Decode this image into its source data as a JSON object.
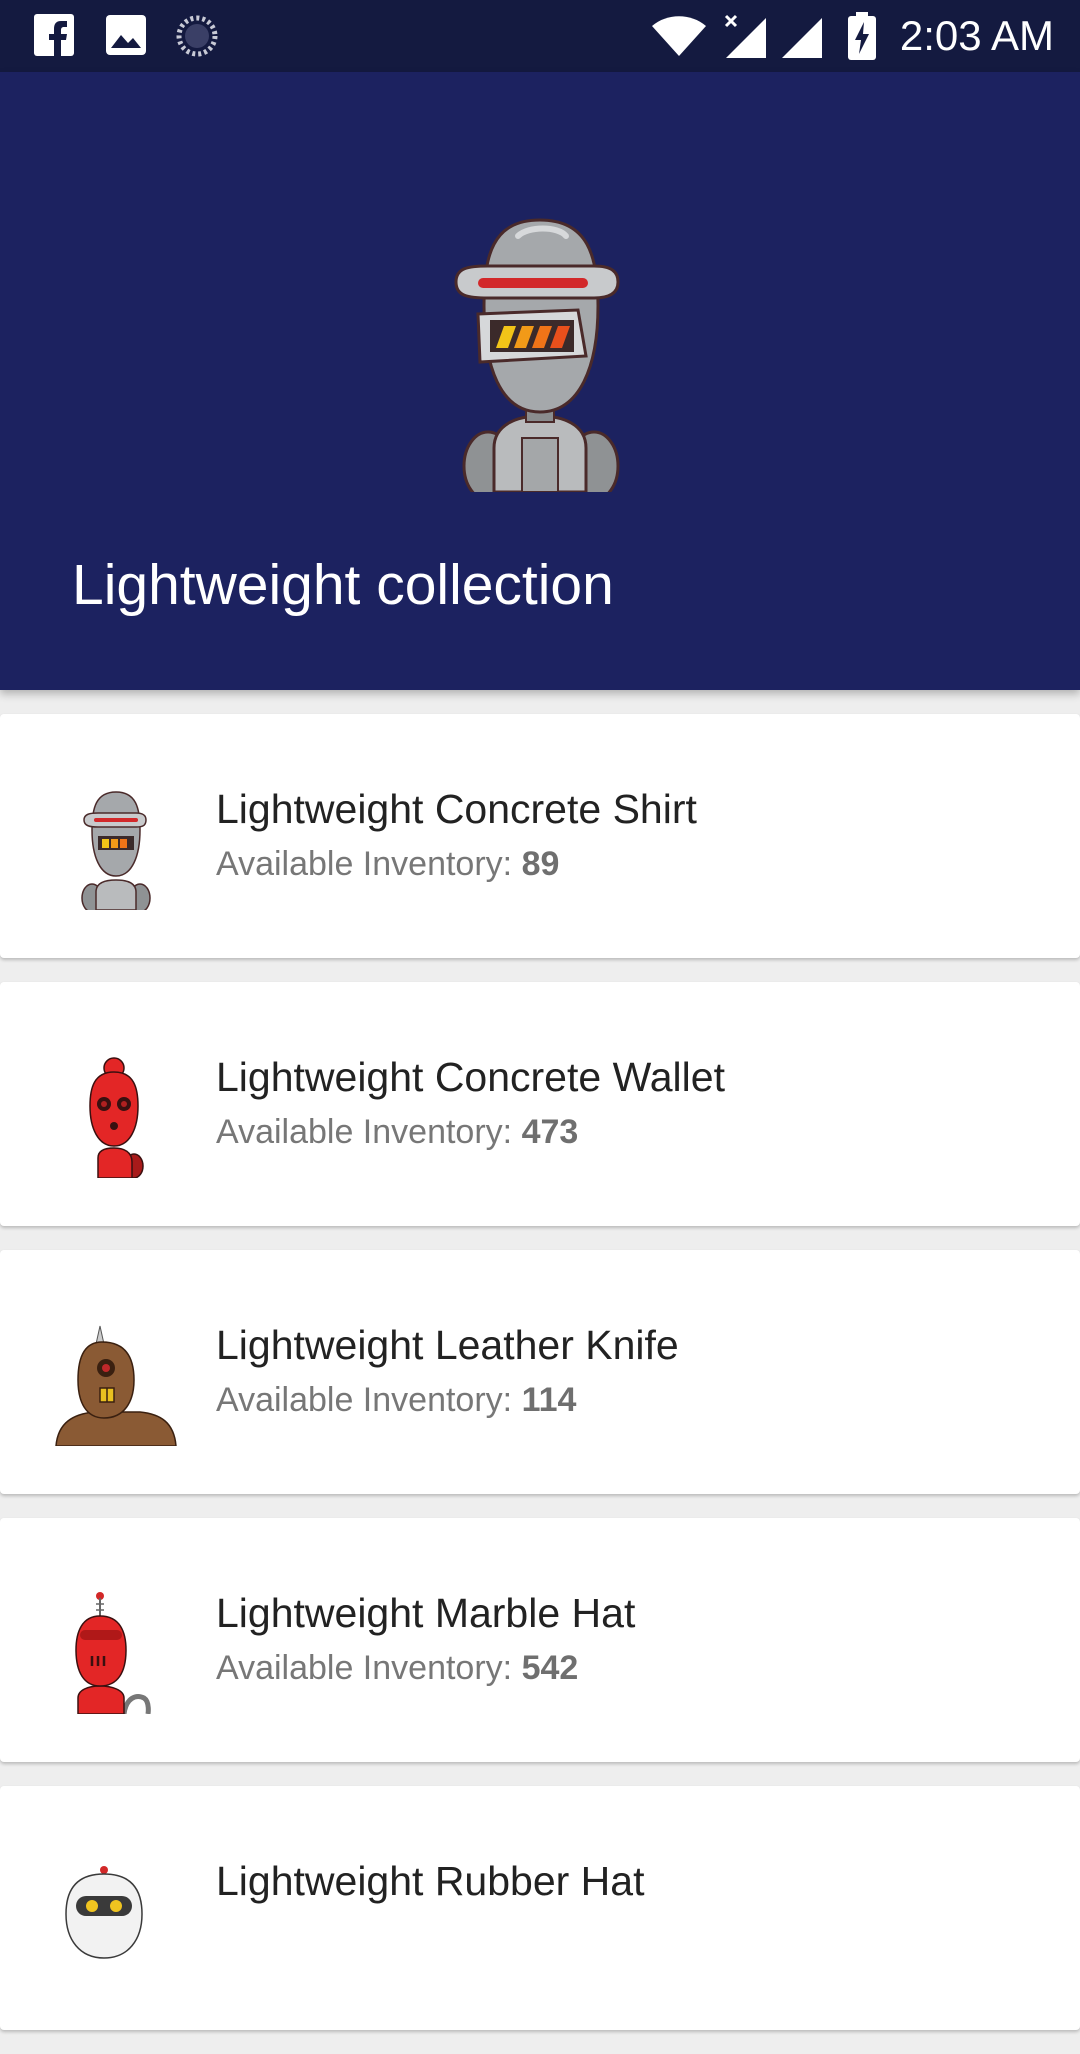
{
  "status_bar": {
    "time": "2:03 AM",
    "left_icons": [
      "facebook-icon",
      "image-icon",
      "sync-icon"
    ],
    "right_icons": [
      "wifi-icon",
      "signal-no-data-icon",
      "signal-icon",
      "battery-charging-icon"
    ]
  },
  "header": {
    "title": "Lightweight collection",
    "background_color": "#1c2260",
    "hero_image": "gray-robot-image"
  },
  "products": [
    {
      "name": "Lightweight Concrete Shirt",
      "inventory_label": "Available Inventory:",
      "inventory": "89",
      "thumbnail": "gray-robot-image"
    },
    {
      "name": "Lightweight Concrete Wallet",
      "inventory_label": "Available Inventory:",
      "inventory": "473",
      "thumbnail": "red-robot-image"
    },
    {
      "name": "Lightweight Leather Knife",
      "inventory_label": "Available Inventory:",
      "inventory": "114",
      "thumbnail": "brown-robot-image"
    },
    {
      "name": "Lightweight Marble Hat",
      "inventory_label": "Available Inventory:",
      "inventory": "542",
      "thumbnail": "red-antenna-robot-image"
    },
    {
      "name": "Lightweight Rubber Hat",
      "thumbnail": "white-robot-image"
    }
  ],
  "colors": {
    "status_bar": "#141a40",
    "header": "#1c2260",
    "card": "#ffffff",
    "list_background": "#eeeeee"
  }
}
